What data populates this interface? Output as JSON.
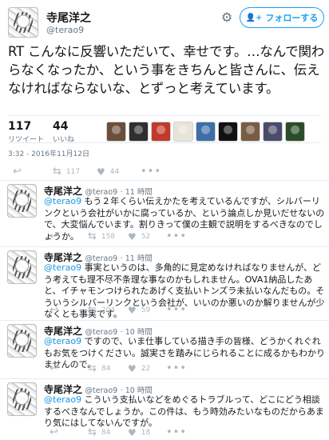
{
  "tweet": {
    "author_name": "寺尾洋之",
    "author_handle": "@terao9",
    "follow_label": "フォローする",
    "text": "RT こんなに反響いただいて、幸せです。…なんで関わらなくなったか、という事をきちんと皆さんに、伝えなければならないな、とずっと考えています。",
    "retweets": "117",
    "retweets_label": "リツイート",
    "likes": "44",
    "likes_label": "いいね",
    "timestamp": "3:32 - 2016年11月12日",
    "action_retweets": "117",
    "action_likes": "44"
  },
  "likers": [
    {
      "color": "#6b4f3a"
    },
    {
      "color": "#2f2f2f"
    },
    {
      "color": "#c23a2b"
    },
    {
      "color": "#e8e4d8"
    },
    {
      "color": "#3d6ea8"
    },
    {
      "color": "#111111"
    },
    {
      "color": "#7a5c45"
    },
    {
      "color": "#4b4b6a"
    },
    {
      "color": "#2a4d2a"
    }
  ],
  "replies": [
    {
      "name": "寺尾洋之",
      "handle": "@terao9",
      "time": "· 11 時間",
      "mention": "@terao9",
      "text": " もう２年くらい伝えかたを考えているんですが、シルバーリンクという会社がいかに腐っているか、という論点しか見いだせないので、大変悩んでいます。割りきって僕の主観で説明をするべきなのでしょうか。",
      "retweets": "158",
      "likes": "52"
    },
    {
      "name": "寺尾洋之",
      "handle": "@terao9",
      "time": "· 11 時間",
      "mention": "@terao9",
      "text": " 事実というのは、多角的に見定めなければなりませんが、どう考えても理不尽不条理な事なのかもしれません。OVA1納品したあと、イチャモンつけられたあげく支払いトンズラ未払いなんだもの。そういうシルバーリンクという会社が、いいのか悪いのか解りませんが少なくとも事実です。",
      "retweets": "204",
      "likes": "59"
    },
    {
      "name": "寺尾洋之",
      "handle": "@terao9",
      "time": "· 10 時間",
      "mention": "@terao9",
      "text": " ですので、いま仕事している描き手の皆様、どうかくれぐれもお気をつけください。誠実さを踏みにじられることに成るかもわかりませんので。",
      "retweets": "84",
      "likes": "22"
    },
    {
      "name": "寺尾洋之",
      "handle": "@terao9",
      "time": "· 10 時間",
      "mention": "@terao9",
      "text": " こういう支払いなどをめぐるトラブルって、どこにどう相談するべきなんでしょうか。この件は、もう時効みたいなものだからあまり気にはしてないんですが。",
      "retweets": "84",
      "likes": "18"
    }
  ],
  "icons": {
    "reply": "↩",
    "retweet": "⇆",
    "like": "♥",
    "more": "•••",
    "gear": "⚙",
    "follow": "👤+"
  }
}
